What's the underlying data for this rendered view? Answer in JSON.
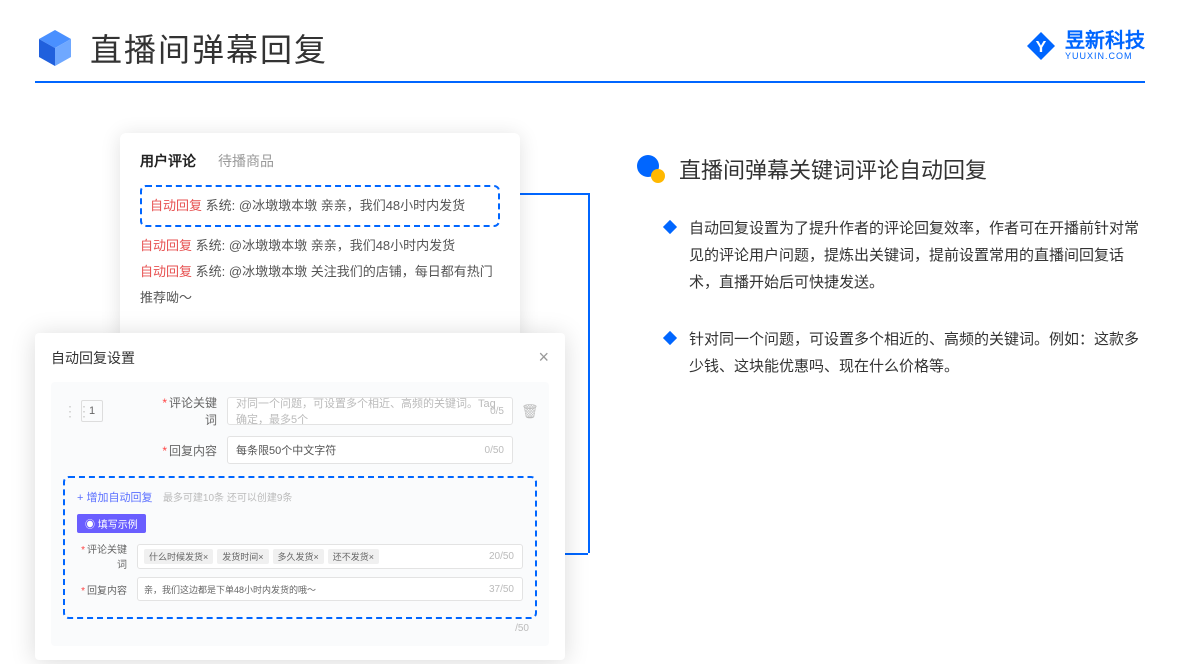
{
  "header": {
    "title": "直播间弹幕回复"
  },
  "logo": {
    "text": "昱新科技",
    "sub": "YUUXIN.COM"
  },
  "comments_panel": {
    "tab_active": "用户评论",
    "tab_inactive": "待播商品",
    "rows": [
      {
        "auto": "自动回复",
        "sys": "系统:",
        "text": "@冰墩墩本墩 亲亲，我们48小时内发货"
      },
      {
        "auto": "自动回复",
        "sys": "系统:",
        "text": "@冰墩墩本墩 亲亲，我们48小时内发货"
      },
      {
        "auto": "自动回复",
        "sys": "系统:",
        "text": "@冰墩墩本墩 关注我们的店铺，每日都有热门推荐呦～"
      }
    ]
  },
  "settings": {
    "title": "自动回复设置",
    "num": "1",
    "keyword_label": "评论关键词",
    "keyword_placeholder": "对同一个问题，可设置多个相近、高频的关键词。Tag确定，最多5个",
    "keyword_counter": "0/5",
    "content_label": "回复内容",
    "content_placeholder": "每条限50个中文字符",
    "content_counter": "0/50",
    "add_text": "+ 增加自动回复",
    "add_hint": "最多可建10条 还可以创建9条",
    "example_badge": "◉ 填写示例",
    "example_kw_label": "评论关键词",
    "example_tags": [
      "什么时候发货×",
      "发货时间×",
      "多久发货×",
      "还不发货×"
    ],
    "example_kw_counter": "20/50",
    "example_content_label": "回复内容",
    "example_content_text": "亲，我们这边都是下单48小时内发货的哦～",
    "example_content_counter": "37/50",
    "extra_counter": "/50"
  },
  "right": {
    "section_title": "直播间弹幕关键词评论自动回复",
    "bullets": [
      "自动回复设置为了提升作者的评论回复效率，作者可在开播前针对常见的评论用户问题，提炼出关键词，提前设置常用的直播间回复话术，直播开始后可快捷发送。",
      "针对同一个问题，可设置多个相近的、高频的关键词。例如：这款多少钱、这块能优惠吗、现在什么价格等。"
    ]
  }
}
